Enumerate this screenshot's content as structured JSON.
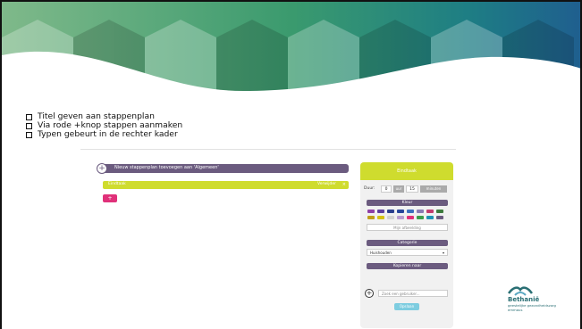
{
  "bullets": [
    "Titel geven aan stappenplan",
    "Via rode +knop stappen aanmaken",
    "Typen gebeurt in de rechter kader"
  ],
  "app": {
    "new_plan_label": "Nieuw stappenplan toevoegen aan 'Algemeen'",
    "step_label": "Eindtaak",
    "step_action": "Verwijder",
    "add_step": "+",
    "panel": {
      "title": "Eindtaak",
      "duration_label": "Duur:",
      "hours": "0",
      "hours_unit": "uur",
      "minutes": "15",
      "minutes_unit": "minuten",
      "color_header": "Kleur",
      "picture_field": "Mijn afbeelding",
      "category_header": "Categorie",
      "category_value": "Huishouden",
      "copy_header": "Kopieren naar",
      "user_search_placeholder": "Zoek een gebruiker...",
      "save_button": "Opslaan"
    },
    "colors": [
      "#8e3fa6",
      "#5e3f9e",
      "#2b3f8e",
      "#28459b",
      "#3d6fbe",
      "#8a7cb5",
      "#c23c6f",
      "#3c7a3c",
      "#c09f1a",
      "#d6c214",
      "#d2d2d2",
      "#ba9ccf",
      "#e0317a",
      "#3c9c4a",
      "#1f92b4",
      "#6b5b7f"
    ]
  },
  "logo": {
    "name": "Bethanië",
    "sub": "geestelijke gezondheidszorg emmaus"
  },
  "accent_colors": {
    "purple": "#6b5b7f",
    "lime": "#cfdc2e",
    "pink": "#e0317a"
  }
}
